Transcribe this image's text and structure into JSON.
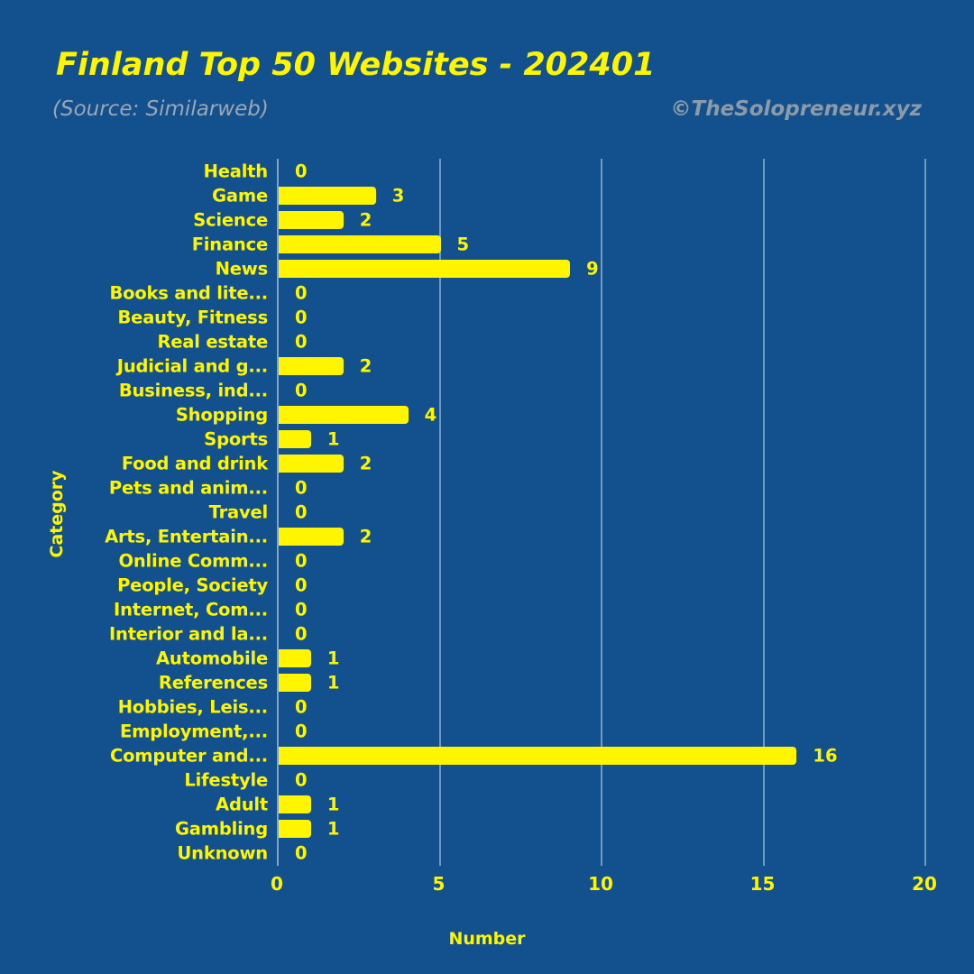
{
  "header": {
    "title": "Finland Top 50 Websites - 202401",
    "subtitle": "(Source: Similarweb)",
    "attribution": "©TheSolopreneur.xyz"
  },
  "colors": {
    "background": "#13518E",
    "bar": "#FFF500",
    "text": "#FFF500",
    "muted": "#9BA7B4",
    "gridline": "#6E9AC4"
  },
  "chart_data": {
    "type": "bar",
    "orientation": "horizontal",
    "title": "Finland Top 50 Websites - 202401",
    "subtitle": "(Source: Similarweb)",
    "xlabel": "Number",
    "ylabel": "Category",
    "xlim": [
      0,
      20
    ],
    "xticks": [
      0,
      5,
      10,
      15,
      20
    ],
    "xtick_labels": [
      "0",
      "5",
      "10",
      "15",
      "20"
    ],
    "grid": "vertical",
    "legend": "none",
    "data_labels": true,
    "categories": [
      "Health",
      "Game",
      "Science",
      "Finance",
      "News",
      "Books and lite...",
      "Beauty, Fitness",
      "Real estate",
      "Judicial and g...",
      "Business, ind...",
      "Shopping",
      "Sports",
      "Food and drink",
      "Pets and anim...",
      "Travel",
      "Arts, Entertain...",
      "Online Comm...",
      "People, Society",
      "Internet, Com...",
      "Interior and la...",
      "Automobile",
      "References",
      "Hobbies, Leis...",
      "Employment,...",
      "Computer and...",
      "Lifestyle",
      "Adult",
      "Gambling",
      "Unknown"
    ],
    "values": [
      0,
      3,
      2,
      5,
      9,
      0,
      0,
      0,
      2,
      0,
      4,
      1,
      2,
      0,
      0,
      2,
      0,
      0,
      0,
      0,
      1,
      1,
      0,
      0,
      16,
      0,
      1,
      1,
      0
    ],
    "value_labels": [
      "0",
      "3",
      "2",
      "5",
      "9",
      "0",
      "0",
      "0",
      "2",
      "0",
      "4",
      "1",
      "2",
      "0",
      "0",
      "2",
      "0",
      "0",
      "0",
      "0",
      "1",
      "1",
      "0",
      "0",
      "16",
      "0",
      "1",
      "1",
      "0"
    ]
  }
}
